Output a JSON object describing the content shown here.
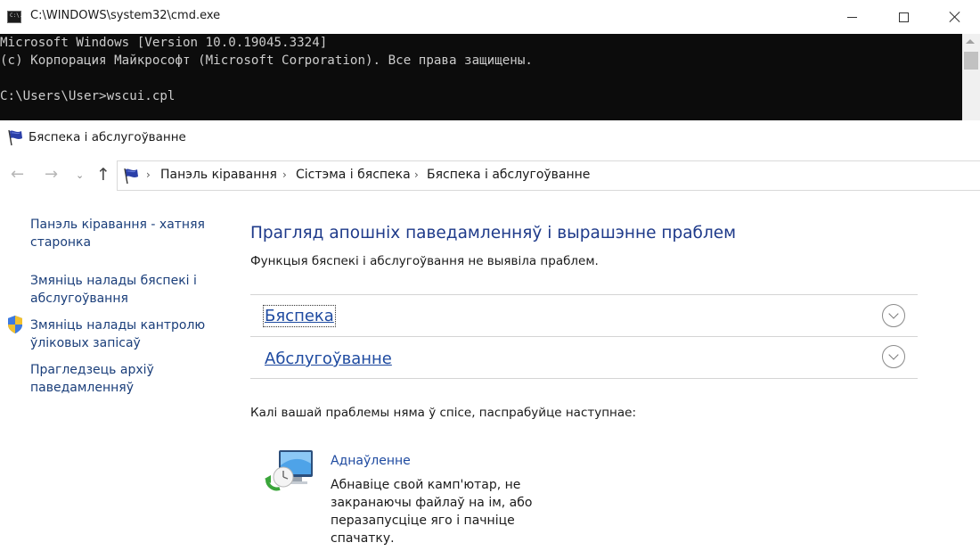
{
  "cmd": {
    "title": "C:\\WINDOWS\\system32\\cmd.exe",
    "icon_label": "C:\\.",
    "lines": [
      "Microsoft Windows [Version 10.0.19045.3324]",
      "(c) Корпорация Майкрософт (Microsoft Corporation). Все права защищены.",
      "",
      "C:\\Users\\User>wscui.cpl"
    ],
    "background": "#0c0c0c",
    "foreground": "#cccccc"
  },
  "control_panel": {
    "window_title": "Бяспека і абслугоўванне",
    "nav": {
      "back_icon": "arrow-left-icon",
      "forward_icon": "arrow-right-icon",
      "recent_icon": "chevron-down-icon",
      "up_icon": "arrow-up-icon"
    },
    "breadcrumb": [
      "Панэль кіравання",
      "Сістэма і бяспека",
      "Бяспека і абслугоўванне"
    ],
    "left_pane": {
      "links": [
        [
          "Панэль кіравання - хатняя",
          "старонка"
        ],
        [
          "Змяніць налады бяспекі і",
          "абслугоўвання"
        ],
        [
          "Змяніць налады кантролю",
          "ўліковых запісаў"
        ],
        [
          "Прагледзець архіў",
          "паведамленняў"
        ]
      ]
    },
    "main": {
      "heading": "Прагляд апошніх паведамленняў і вырашэнне праблем",
      "subtext": "Функцыя бяспекі і абслугоўвання не выявіла праблем.",
      "sections": [
        "Бяспека",
        "Абслугоўванне"
      ],
      "suggestion": "Калі вашай праблемы няма ў спісе, паспрабуйце наступнае:",
      "recovery": {
        "link": "Аднаўленне",
        "description": "Абнавіце свой камп'ютар, не закранаючы файлаў на ім, або перазапусціце яго і пачніце спачатку."
      }
    },
    "colors": {
      "link": "#1e4aa0",
      "heading": "#1e3a8a"
    }
  }
}
